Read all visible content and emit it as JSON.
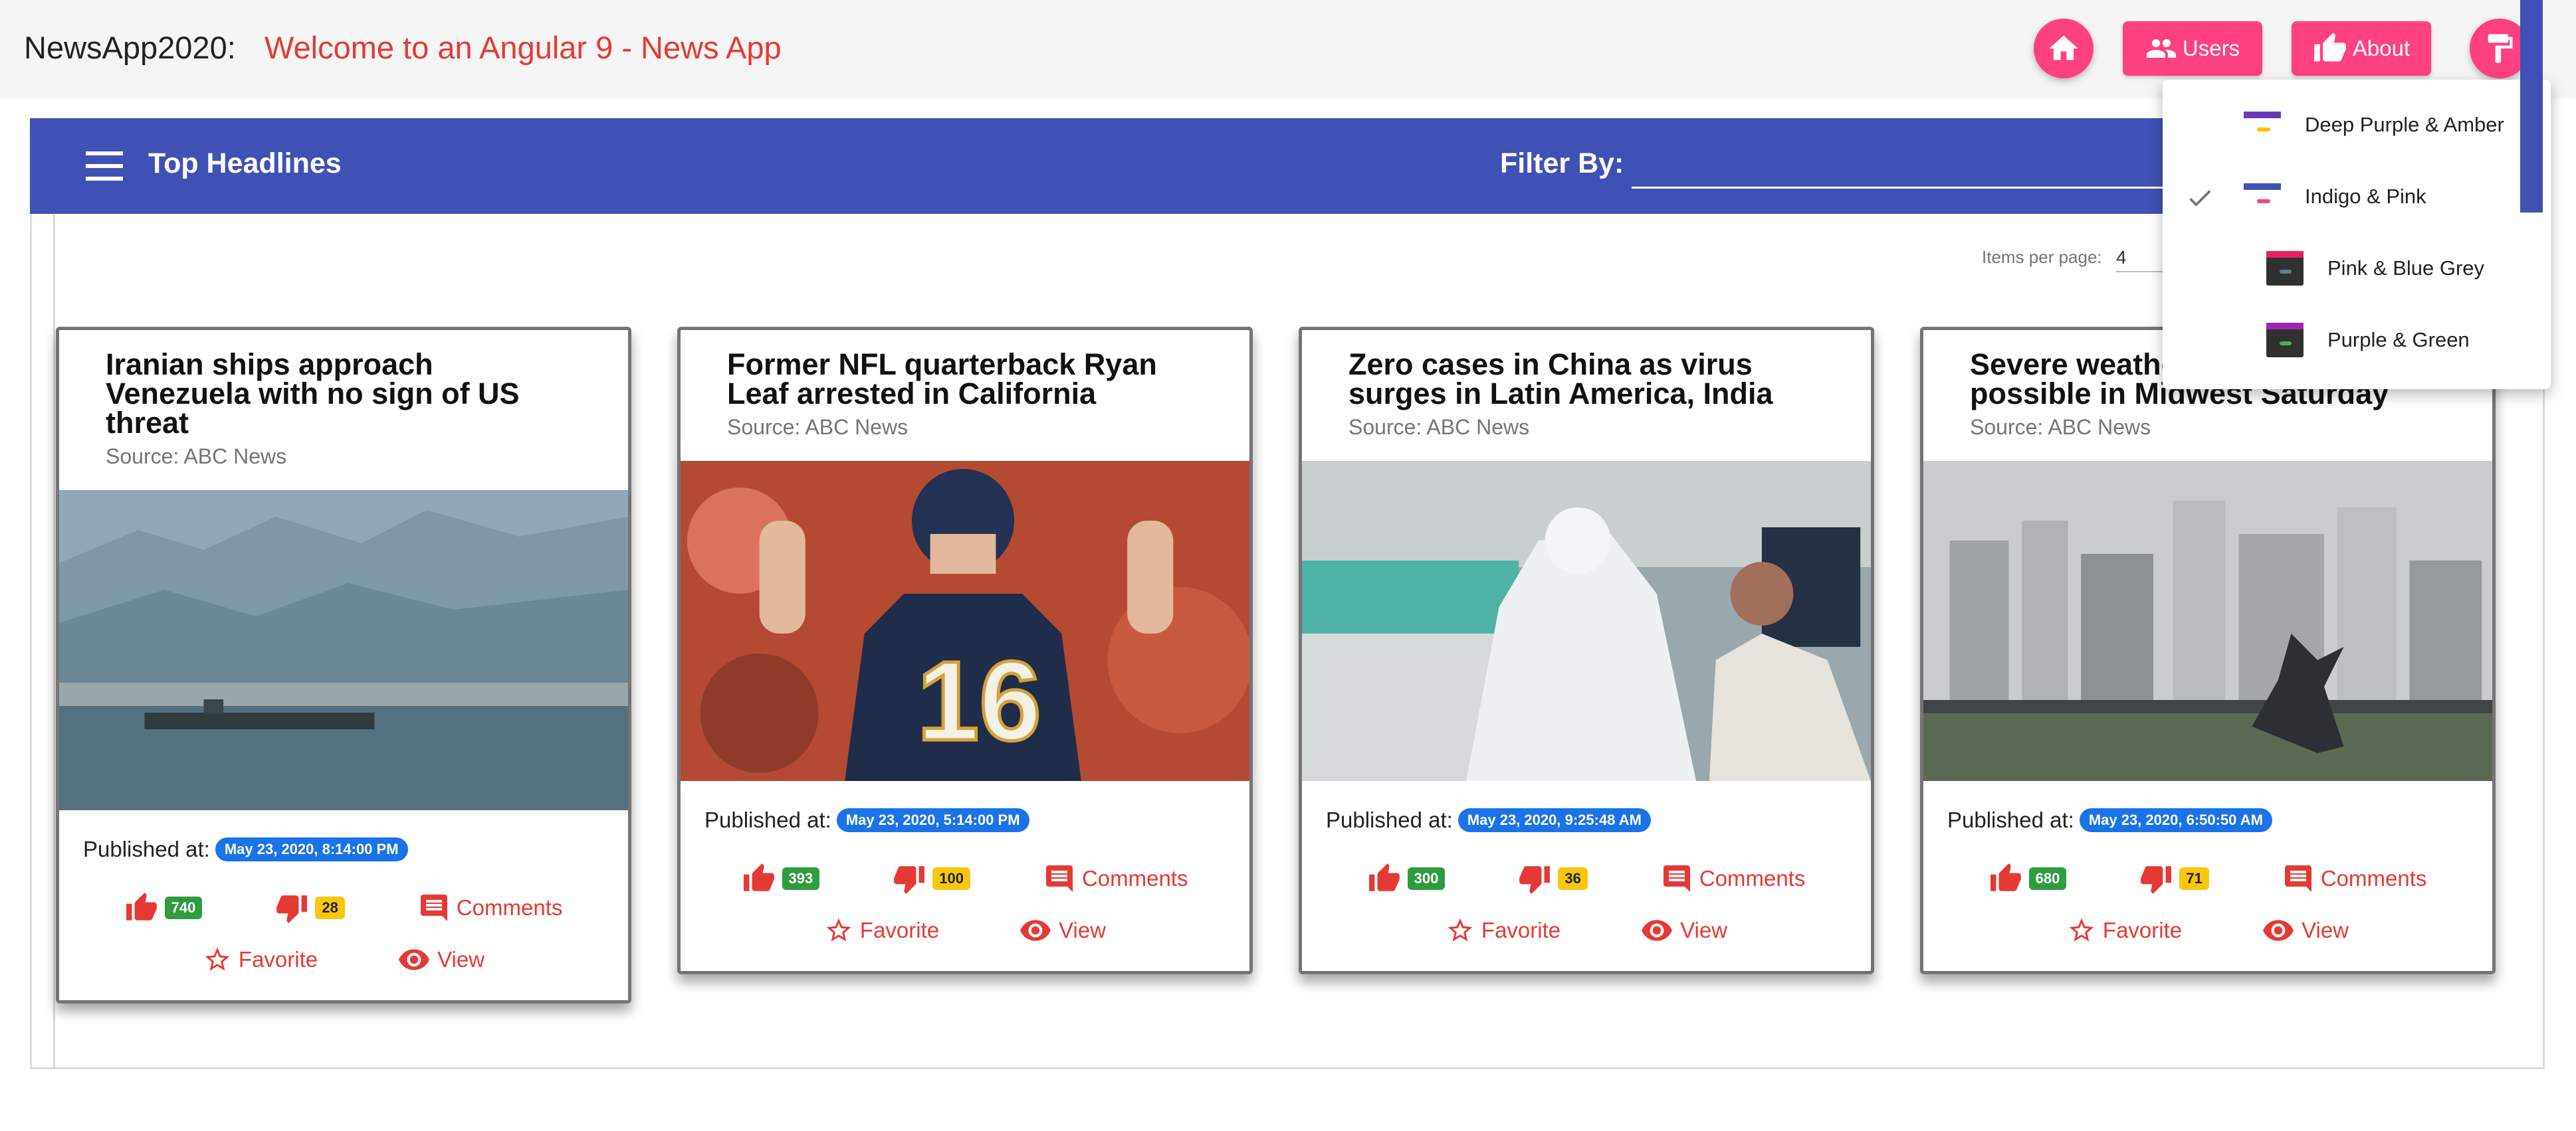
{
  "app": {
    "brand": "NewsApp2020:",
    "welcome": "Welcome to an Angular 9 - News App",
    "accent_color": "#ff4081",
    "warn_color": "#e53935",
    "primary_color": "#3f51b5"
  },
  "nav": {
    "home_icon": "home-icon",
    "users_label": "Users",
    "about_label": "About",
    "theme_icon": "format-paint-icon"
  },
  "toolbar": {
    "title": "Top Headlines",
    "filter_label": "Filter By:",
    "filter_value": ""
  },
  "paginator": {
    "label": "Items per page:",
    "value": "4"
  },
  "theme_menu": {
    "items": [
      {
        "label": "Deep Purple & Amber",
        "selected": false,
        "primary": "#673ab7",
        "accent": "#ffc107"
      },
      {
        "label": "Indigo & Pink",
        "selected": true,
        "primary": "#3f51b5",
        "accent": "#ff4081"
      },
      {
        "label": "Pink & Blue Grey",
        "selected": false,
        "primary": "#e91e63",
        "accent": "#607d8b"
      },
      {
        "label": "Purple & Green",
        "selected": false,
        "primary": "#9c27b0",
        "accent": "#4caf50"
      }
    ]
  },
  "cards": [
    {
      "title": "Iranian ships approach Venezuela with no sign of US threat",
      "source": "Source: ABC News",
      "published_label": "Published at:",
      "published": "May 23, 2020, 8:14:00 PM",
      "likes": "740",
      "dislikes": "28",
      "comments_label": "Comments",
      "favorite_label": "Favorite",
      "view_label": "View"
    },
    {
      "title": "Former NFL quarterback Ryan Leaf arrested in California",
      "source": "Source: ABC News",
      "published_label": "Published at:",
      "published": "May 23, 2020, 5:14:00 PM",
      "likes": "393",
      "dislikes": "100",
      "comments_label": "Comments",
      "favorite_label": "Favorite",
      "view_label": "View"
    },
    {
      "title": "Zero cases in China as virus surges in Latin America, India",
      "source": "Source: ABC News",
      "published_label": "Published at:",
      "published": "May 23, 2020, 9:25:48 AM",
      "likes": "300",
      "dislikes": "36",
      "comments_label": "Comments",
      "favorite_label": "Favorite",
      "view_label": "View"
    },
    {
      "title": "Severe weather tornado threat possible in Midwest Saturday",
      "source": "Source: ABC News",
      "published_label": "Published at:",
      "published": "May 23, 2020, 6:50:50 AM",
      "likes": "680",
      "dislikes": "71",
      "comments_label": "Comments",
      "favorite_label": "Favorite",
      "view_label": "View"
    }
  ]
}
